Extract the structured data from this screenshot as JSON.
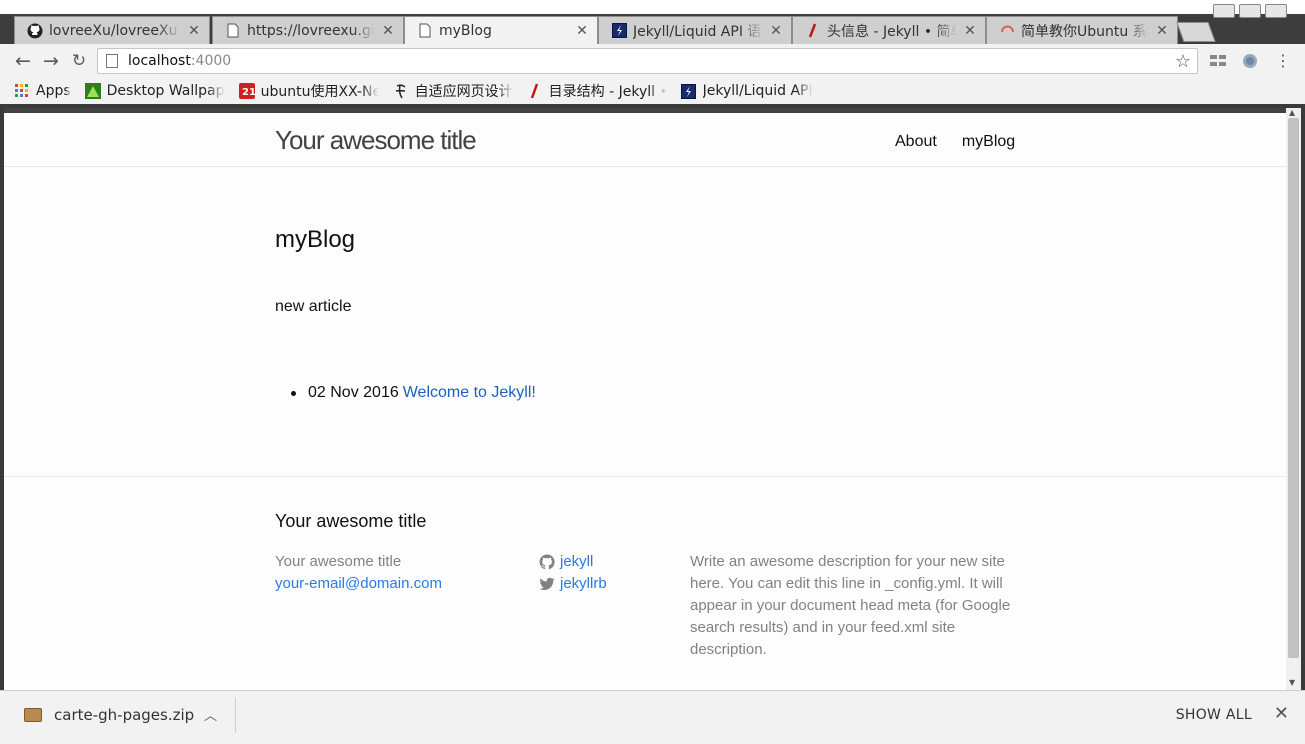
{
  "browser": {
    "tabs": [
      {
        "title": "lovreeXu/lovreeXu.github.io",
        "favicon": "github-icon",
        "active": false
      },
      {
        "title": "https://lovreexu.github.io",
        "favicon": "page-icon",
        "active": false
      },
      {
        "title": "myBlog",
        "favicon": "page-icon",
        "active": true
      },
      {
        "title": "Jekyll/Liquid API 语法",
        "favicon": "jekyll-docs-icon",
        "active": false
      },
      {
        "title": "头信息 - Jekyll • 简单静态博客",
        "favicon": "jekyll-tube-icon",
        "active": false
      },
      {
        "title": "简单教你Ubuntu 系统",
        "favicon": "loading-icon",
        "active": false
      }
    ],
    "address": {
      "host": "localhost",
      "port": ":4000"
    },
    "bookmarks": [
      {
        "label": "Apps",
        "icon": "apps-grid-icon"
      },
      {
        "label": "Desktop Wallpapers",
        "icon": "wallpaper-icon"
      },
      {
        "label": "ubuntu使用XX-Net",
        "icon": "red-badge-icon"
      },
      {
        "label": "自适应网页设计",
        "icon": "script-icon"
      },
      {
        "label": "目录结构 - Jekyll • 简单",
        "icon": "jekyll-tube-icon"
      },
      {
        "label": "Jekyll/Liquid API",
        "icon": "jekyll-docs-icon"
      }
    ],
    "colors": {
      "tab_bg": "#cfcfcf",
      "active_tab_bg": "#f2f2f2",
      "toolbar_bg": "#f2f2f2",
      "link": "#2a7ae2"
    }
  },
  "site": {
    "title": "Your awesome title",
    "nav": [
      "About",
      "myBlog"
    ]
  },
  "main": {
    "heading": "myBlog",
    "lead": "new article",
    "posts": [
      {
        "date": "02 Nov 2016",
        "title": "Welcome to Jekyll!"
      }
    ]
  },
  "footer": {
    "heading": "Your awesome title",
    "name": "Your awesome title",
    "email": "your-email@domain.com",
    "github": "jekyll",
    "twitter": "jekyllrb",
    "description": "Write an awesome description for your new site here. You can edit this line in _config.yml. It will appear in your document head meta (for Google search results) and in your feed.xml site description."
  },
  "downloads": {
    "file": "carte-gh-pages.zip",
    "show_all": "SHOW ALL"
  }
}
